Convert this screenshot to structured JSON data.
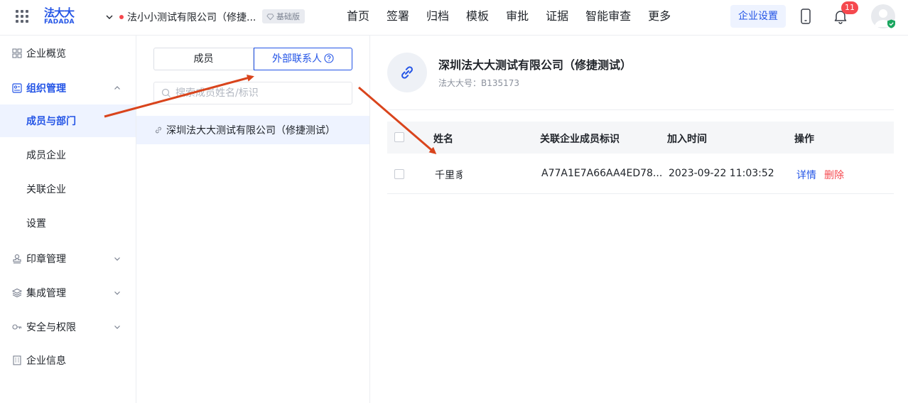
{
  "header": {
    "logo": {
      "zh": "法大大",
      "en": "FADADA"
    },
    "company_name": "法小小测试有限公司（修捷...",
    "edition": "基础版",
    "nav": [
      "首页",
      "签署",
      "归档",
      "模板",
      "审批",
      "证据",
      "智能审查",
      "更多"
    ],
    "enterprise_settings": "企业设置",
    "notification_count": "11"
  },
  "sidebar": {
    "overview": "企业概览",
    "org_management": "组织管理",
    "sub": {
      "members_depts": "成员与部门",
      "member_enterprises": "成员企业",
      "linked_enterprises": "关联企业",
      "settings": "设置"
    },
    "seal_management": "印章管理",
    "integration_management": "集成管理",
    "security_permissions": "安全与权限",
    "enterprise_info": "企业信息"
  },
  "middle": {
    "tab_members": "成员",
    "tab_external": "外部联系人",
    "search_placeholder": "搜索成员姓名/标识",
    "tree_item": "深圳法大大测试有限公司（修捷测试）"
  },
  "main": {
    "org_name": "深圳法大大测试有限公司（修捷测试）",
    "org_code": "法大大号：B135173",
    "columns": {
      "name": "姓名",
      "member_id": "关联企业成员标识",
      "joined": "加入时间",
      "actions": "操作"
    },
    "rows": [
      {
        "name": "千里豸",
        "member_id": "A77A1E7A66AA4ED78...",
        "joined": "2023-09-22 11:03:52",
        "detail": "详情",
        "delete": "删除"
      }
    ]
  },
  "colors": {
    "brand": "#2354e6",
    "danger": "#f5484e",
    "annotation_arrow": "#d9441c"
  }
}
